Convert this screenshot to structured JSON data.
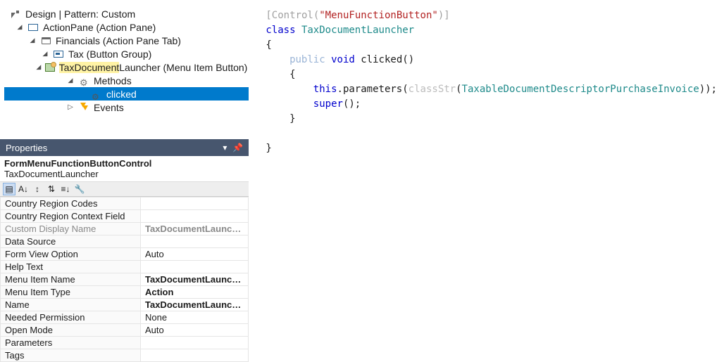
{
  "tree": {
    "design_label": "Design | Pattern: Custom",
    "actionpane_label": "ActionPane (Action Pane)",
    "financials_label": "Financials (Action Pane Tab)",
    "tax_label": "Tax (Button Group)",
    "launcher_prefix": "TaxDocument",
    "launcher_suffix": "Launcher (Menu Item Button)",
    "methods_label": "Methods",
    "clicked_label": "clicked",
    "events_label": "Events"
  },
  "properties": {
    "panel_title": "Properties",
    "type_label": "FormMenuFunctionButtonControl",
    "instance_name": "TaxDocumentLauncher",
    "rows": [
      {
        "name": "Country Region Codes",
        "value": ""
      },
      {
        "name": "Country Region Context Field",
        "value": ""
      },
      {
        "name": "Custom Display Name",
        "value": "TaxDocumentLauncher (Menu Item Button)",
        "grayed": true,
        "bold_value": true
      },
      {
        "name": "Data Source",
        "value": ""
      },
      {
        "name": "Form View Option",
        "value": "Auto"
      },
      {
        "name": "Help Text",
        "value": ""
      },
      {
        "name": "Menu Item Name",
        "value": "TaxDocumentLauncher",
        "bold_value": true
      },
      {
        "name": "Menu Item Type",
        "value": "Action",
        "bold_value": true
      },
      {
        "name": "Name",
        "value": "TaxDocumentLauncher",
        "bold_value": true
      },
      {
        "name": "Needed Permission",
        "value": "None"
      },
      {
        "name": "Open Mode",
        "value": "Auto"
      },
      {
        "name": "Parameters",
        "value": ""
      },
      {
        "name": "Tags",
        "value": ""
      }
    ]
  },
  "code": {
    "attr_open": "[",
    "attr_name": "Control",
    "attr_paren_open": "(",
    "attr_string": "\"MenuFunctionButton\"",
    "attr_close": ")]",
    "kw_class": "class",
    "class_name": "TaxDocumentLauncher",
    "brace_open": "{",
    "kw_public": "public",
    "kw_void": "void",
    "method_name": "clicked",
    "empty_parens": "()",
    "kw_this": "this",
    "call_params": ".parameters(",
    "fn_classStr": "classStr",
    "arg_open": "(",
    "arg_type": "TaxableDocumentDescriptorPurchaseInvoice",
    "arg_close": "));",
    "kw_super": "super",
    "semi": "();",
    "brace_close": "}"
  }
}
